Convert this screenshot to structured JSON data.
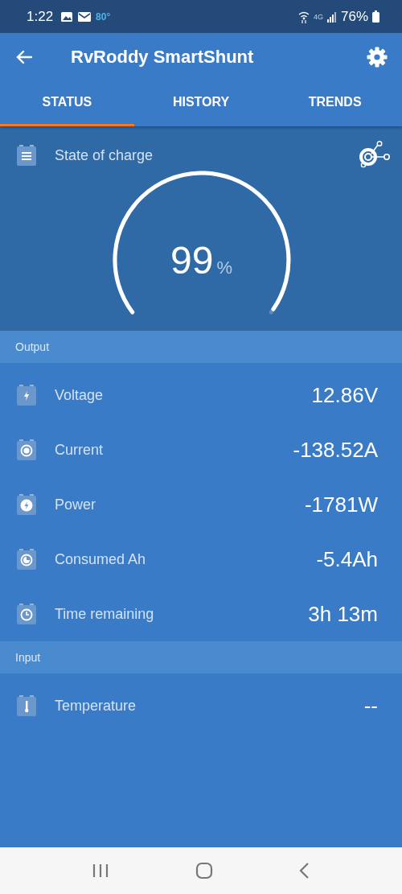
{
  "status_bar": {
    "time": "1:22",
    "weather": "80°",
    "network": "4G",
    "battery": "76%"
  },
  "app_bar": {
    "title": "RvRoddy SmartShunt"
  },
  "tabs": [
    {
      "label": "STATUS",
      "selected": true
    },
    {
      "label": "HISTORY",
      "selected": false
    },
    {
      "label": "TRENDS",
      "selected": false
    }
  ],
  "state_of_charge": {
    "label": "State of charge",
    "value": "99",
    "unit": "%"
  },
  "sections": [
    {
      "title": "Output",
      "rows": [
        {
          "kind": "voltage",
          "label": "Voltage",
          "value": "12.86V"
        },
        {
          "kind": "current",
          "label": "Current",
          "value": "-138.52A"
        },
        {
          "kind": "power",
          "label": "Power",
          "value": "-1781W"
        },
        {
          "kind": "consumed",
          "label": "Consumed Ah",
          "value": "-5.4Ah"
        },
        {
          "kind": "time",
          "label": "Time remaining",
          "value": "3h 13m"
        }
      ]
    },
    {
      "title": "Input",
      "rows": [
        {
          "kind": "temperature",
          "label": "Temperature",
          "value": "--"
        }
      ]
    }
  ]
}
